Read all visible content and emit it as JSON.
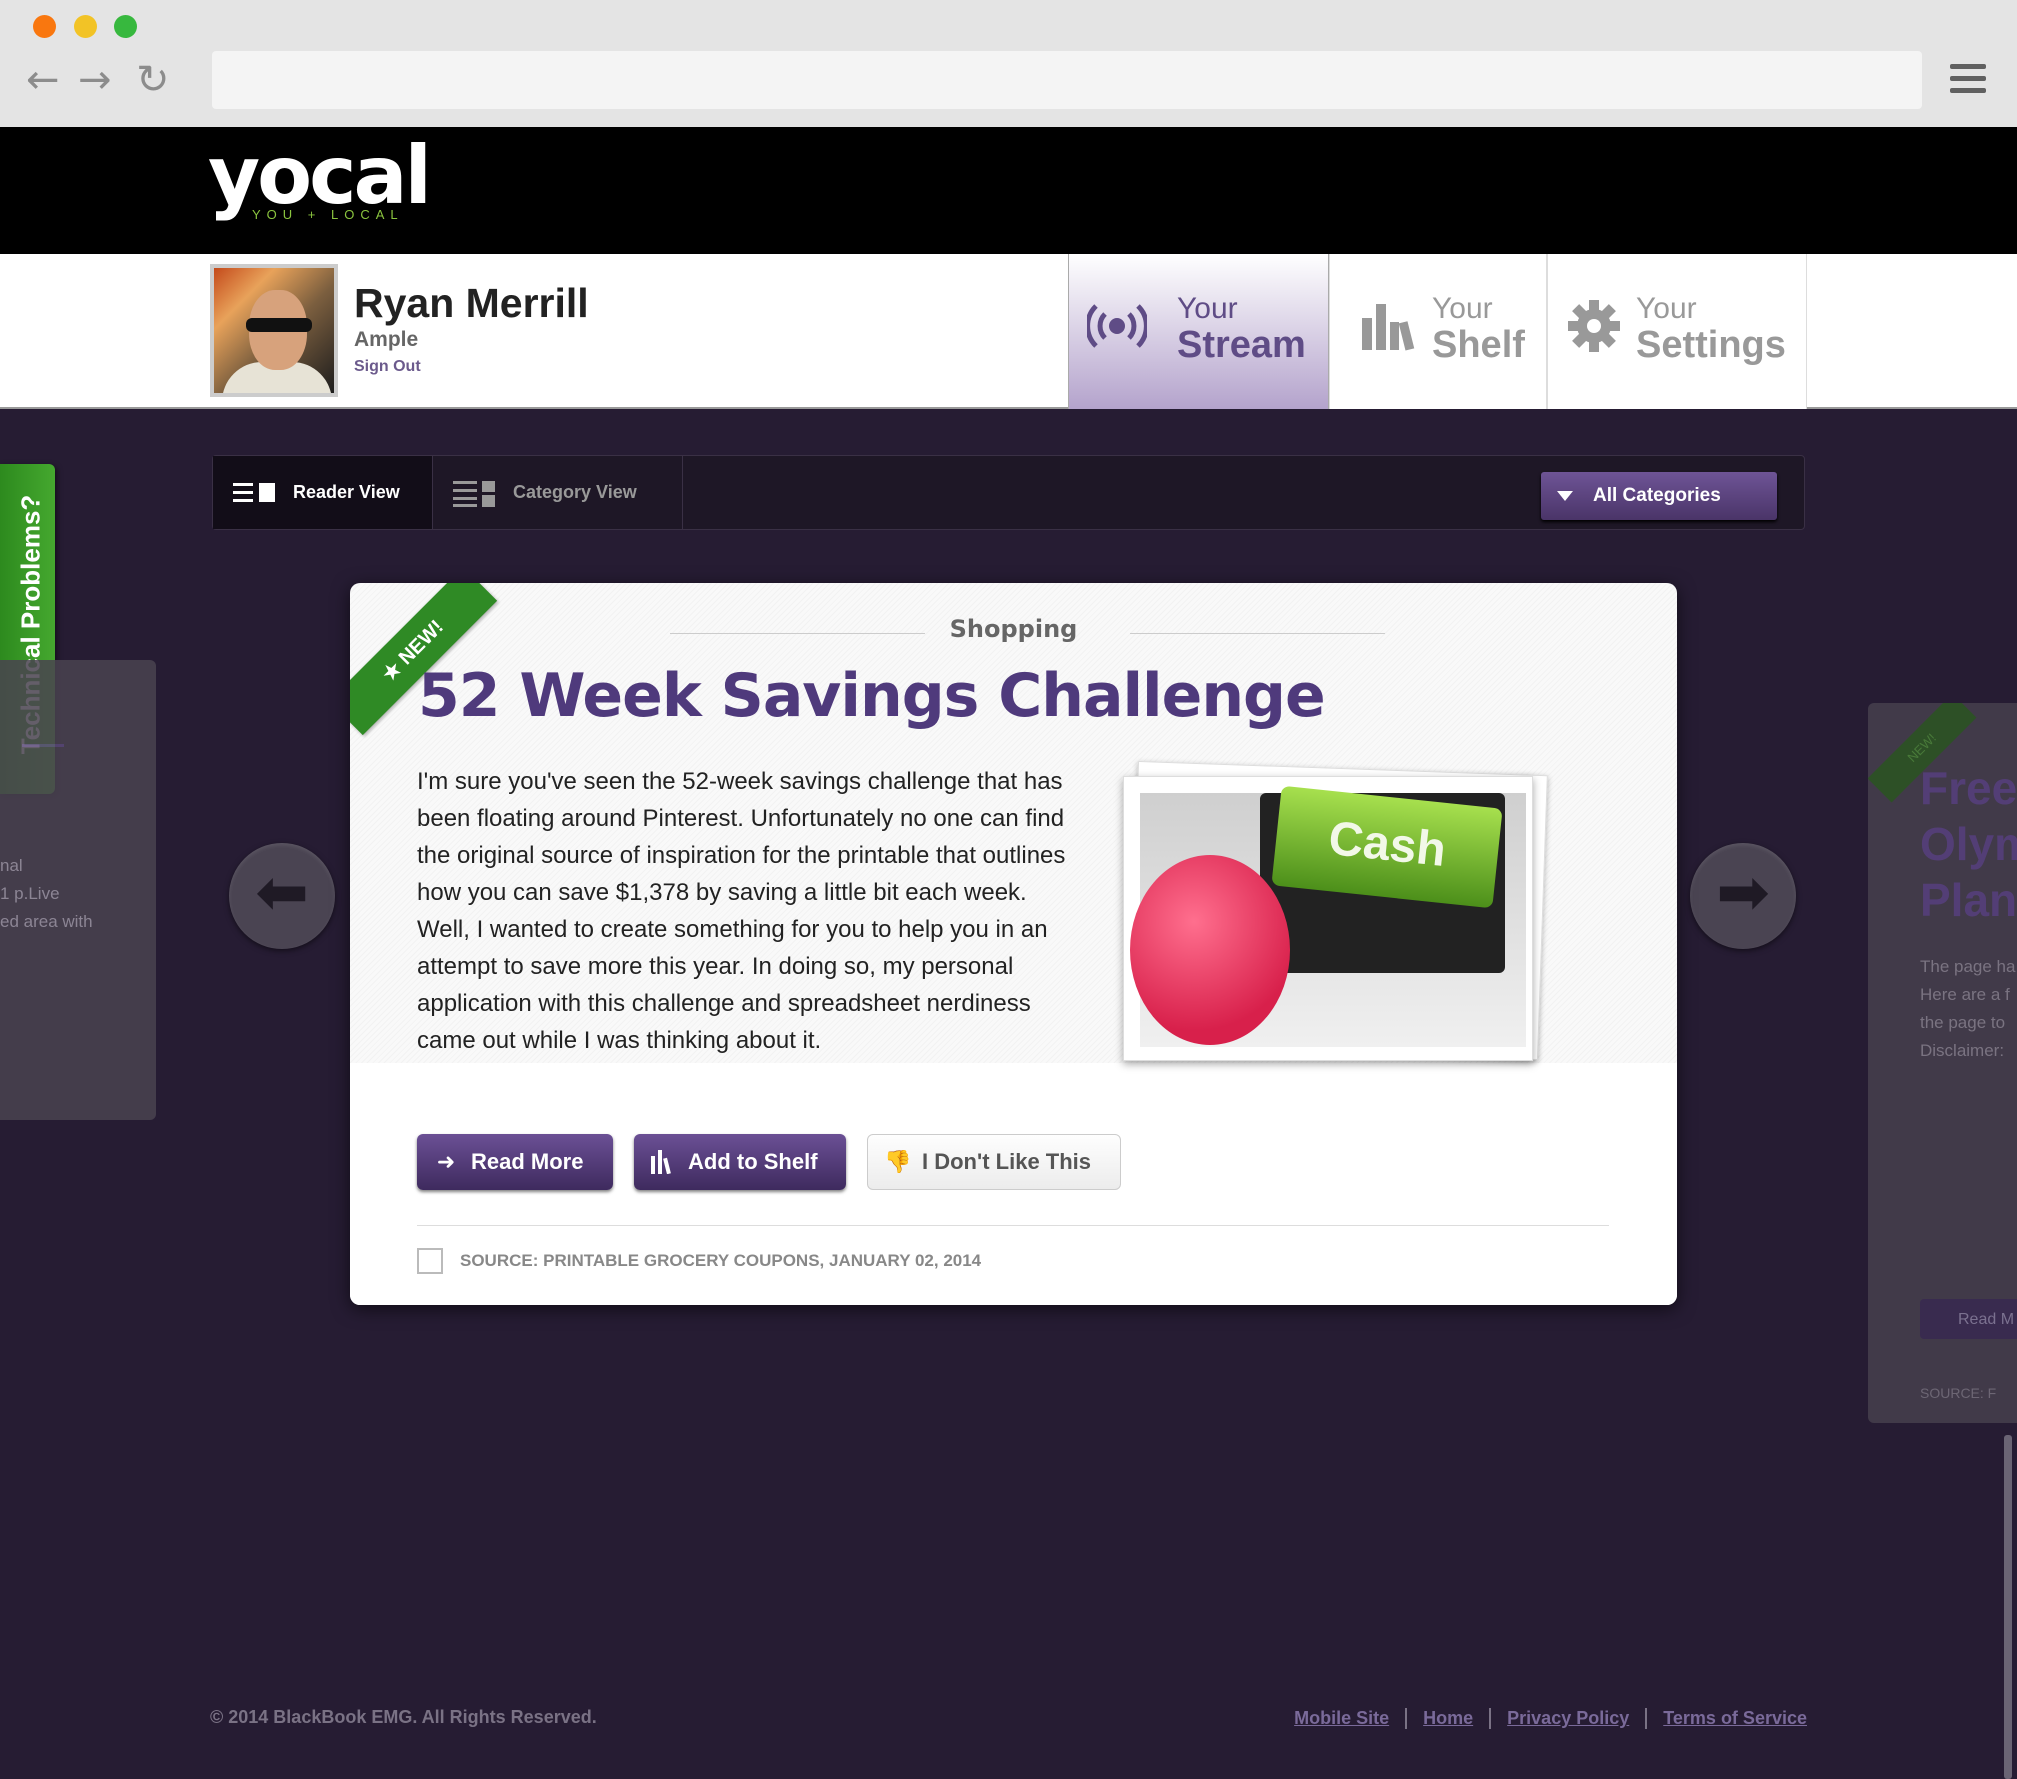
{
  "browser": {
    "menu_icon": "hamburger-menu-icon"
  },
  "header": {
    "logo_word": "yocal",
    "logo_tagline": "YOU + LOCAL",
    "accent": "#8bc53f"
  },
  "user": {
    "name": "Ryan Merrill",
    "company": "Ample",
    "sign_out": "Sign Out"
  },
  "nav": {
    "stream": {
      "line1": "Your",
      "line2": "Stream",
      "icon": "broadcast-icon"
    },
    "shelf": {
      "line1": "Your",
      "line2": "Shelf",
      "icon": "books-icon"
    },
    "settings": {
      "line1": "Your",
      "line2": "Settings",
      "icon": "gear-icon"
    }
  },
  "views": {
    "reader": "Reader View",
    "category": "Category View",
    "all_categories": "All Categories"
  },
  "sidebar_tab": "Technical Problems?",
  "left_card": {
    "lines": [
      "nal",
      "1 p.Live",
      "ed area with"
    ]
  },
  "article": {
    "badge": "★ NEW!",
    "category": "Shopping",
    "title": "52 Week Savings Challenge",
    "body": "I'm sure you've seen the 52-week savings challenge that has been floating around Pinterest. Unfortunately no one can find the original source of inspiration for the printable that outlines how you can save $1,378 by saving a little bit each week. Well, I wanted to create something for you to help you in an attempt to save more this year. In doing so, my  personal application with this challenge and spreadsheet nerdiness came out while I was thinking about it.",
    "image_key_text": "Cash",
    "read_more": "Read More",
    "add_to_shelf": "Add to Shelf",
    "dislike": "I Don't Like This",
    "source": "SOURCE: PRINTABLE GROCERY COUPONS, JANUARY 02, 2014"
  },
  "right_card": {
    "badge": "NEW!",
    "title_lines": [
      "Free",
      "Olym",
      "Plans"
    ],
    "lines": [
      "The page ha",
      "Here are a f",
      "the page to",
      "Disclaimer:"
    ],
    "button": "Read M",
    "source": "SOURCE: F"
  },
  "footer": {
    "copyright": "© 2014 BlackBook EMG. All Rights Reserved.",
    "links": [
      "Mobile Site",
      "Home",
      "Privacy Policy",
      "Terms of Service"
    ]
  },
  "colors": {
    "brand_purple": "#4f3a7c",
    "new_green": "#2f8a25",
    "background": "#261c33"
  }
}
